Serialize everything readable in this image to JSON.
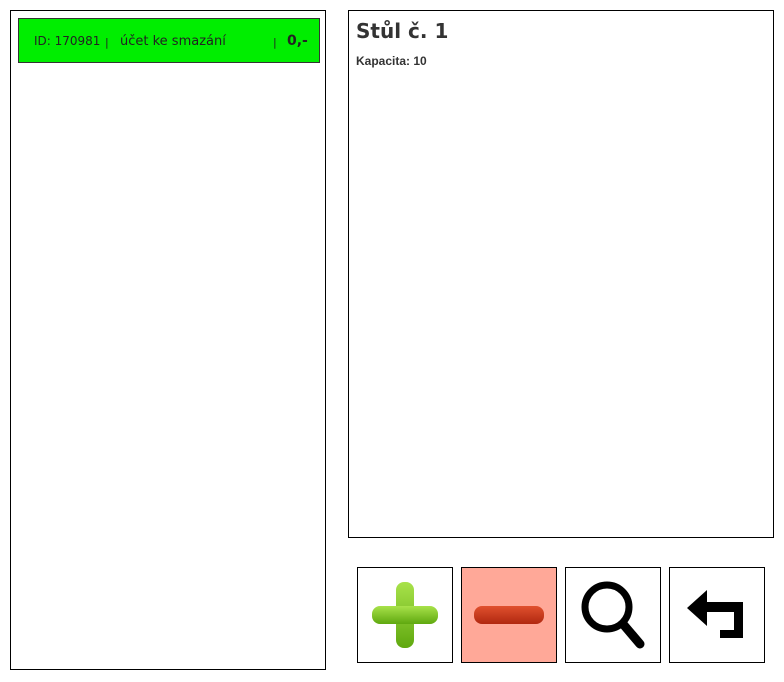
{
  "accounts": [
    {
      "id_text": "ID: 170981",
      "separator": "|",
      "name": "účet ke smazání",
      "amount": "0,-",
      "color": "#00ee00"
    }
  ],
  "table": {
    "title": "Stůl č. 1",
    "capacity_text": "Kapacita: 10"
  },
  "actions": {
    "add": {
      "icon": "plus-icon",
      "color": "#7cc52a"
    },
    "remove": {
      "icon": "minus-icon",
      "color": "#c8331a",
      "background": "#ffa898"
    },
    "search": {
      "icon": "magnifier-icon"
    },
    "back": {
      "icon": "return-arrow-icon"
    }
  }
}
